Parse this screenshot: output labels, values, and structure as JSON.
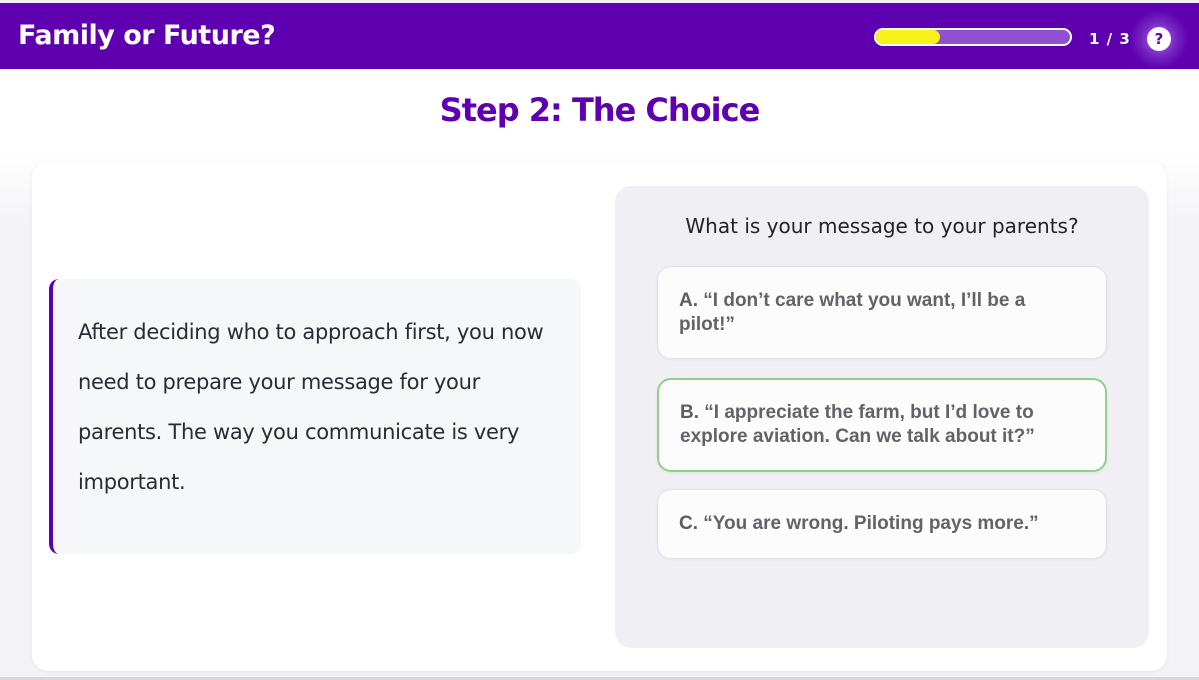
{
  "header": {
    "title": "Family or Future?",
    "progress": {
      "current": 1,
      "total": 3,
      "fill_fraction": 0.33
    },
    "step_counter": "1 / 3",
    "help_icon": "question-circle-icon",
    "help_glyph": "?"
  },
  "colors": {
    "brand_purple": "#5e00b0",
    "progress_fill": "#f7f21a",
    "selected_border": "#8fd18b"
  },
  "main": {
    "step_heading": "Step 2: The Choice",
    "narrative": "After deciding who to approach first, you now need to prepare your message for your parents. The way you communicate is very important.",
    "question": "What is your message to your parents?",
    "options": [
      {
        "letter": "A.",
        "text": "“I don’t care what you want, I’ll be a pilot!”",
        "selected": false
      },
      {
        "letter": "B.",
        "text": "“I appreciate the farm, but I’d love to explore aviation. Can we talk about it?”",
        "selected": true
      },
      {
        "letter": "C.",
        "text": "“You are wrong. Piloting pays more.”",
        "selected": false
      }
    ]
  }
}
